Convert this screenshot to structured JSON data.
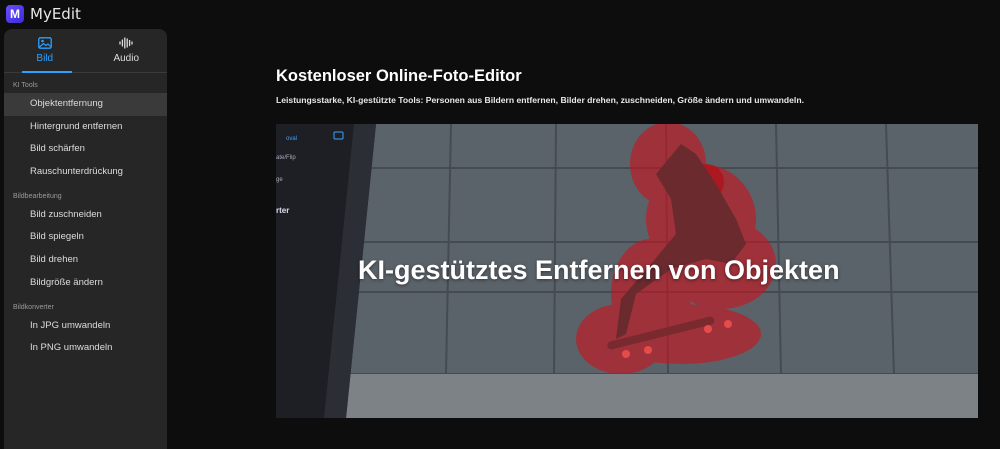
{
  "app": {
    "brand": "MyEdit",
    "logo_letter": "M"
  },
  "tabs": [
    {
      "label": "Bild",
      "icon": "image-icon",
      "active": true
    },
    {
      "label": "Audio",
      "icon": "audio-wave-icon",
      "active": false
    }
  ],
  "sidebar": {
    "sections": [
      {
        "title": "KI Tools",
        "items": [
          "Objektentfernung",
          "Hintergrund entfernen",
          "Bild schärfen",
          "Rauschunterdrückung"
        ]
      },
      {
        "title": "Bildbearbeitung",
        "items": [
          "Bild zuschneiden",
          "Bild spiegeln",
          "Bild drehen",
          "Bildgröße ändern"
        ]
      },
      {
        "title": "Bildkonverter",
        "items": [
          "In JPG umwandeln",
          "In PNG umwandeln"
        ]
      }
    ],
    "active_item": "Objektentfernung"
  },
  "main": {
    "title": "Kostenloser Online-Foto-Editor",
    "subtitle": "Leistungsstarke, KI-gestützte Tools: Personen aus Bildern entfernen, Bilder drehen, zuschneiden, Größe ändern und umwandeln.",
    "hero_text": "KI-gestütztes Entfernen von Objekten",
    "hero_panel": [
      "oval",
      "ate/Flip",
      "ge",
      "rter"
    ]
  },
  "colors": {
    "accent": "#2aa0ff",
    "mask": "#c8141e",
    "brand": "#5a3cf0"
  }
}
